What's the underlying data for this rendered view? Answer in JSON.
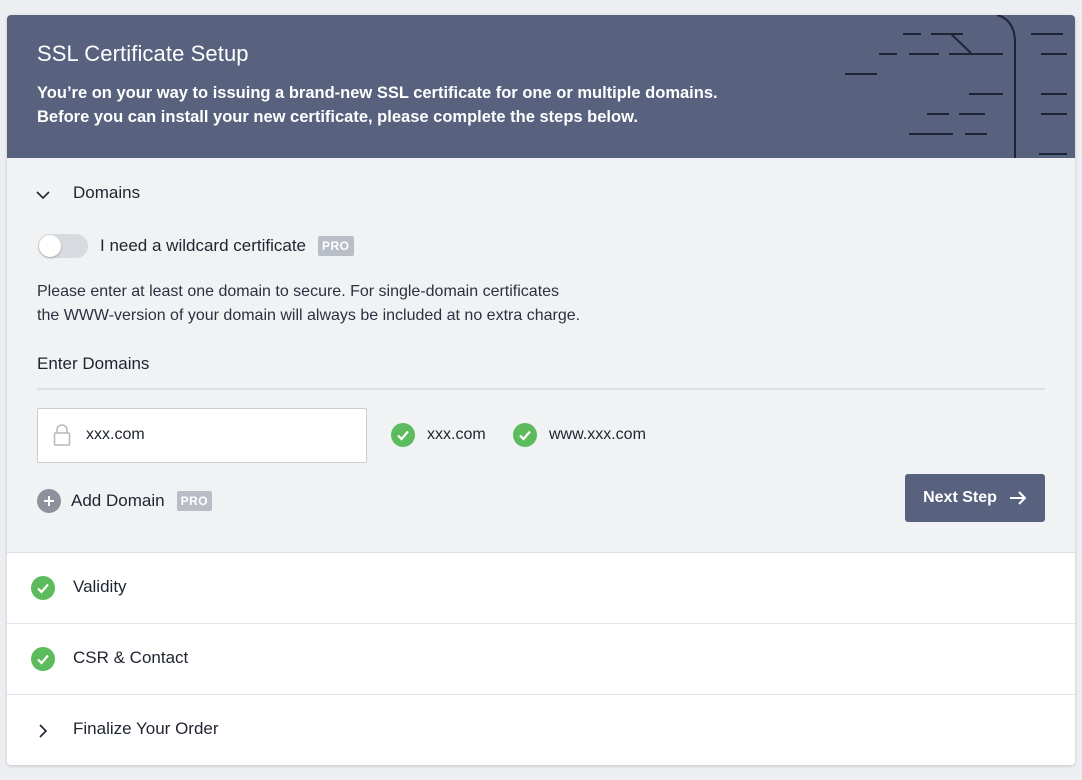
{
  "header": {
    "title": "SSL Certificate Setup",
    "description_line1": "You’re on your way to issuing a brand-new SSL certificate for one or multiple domains.",
    "description_line2": "Before you can install your new certificate, please complete the steps below."
  },
  "domains_section": {
    "title": "Domains",
    "wildcard_label": "I need a wildcard certificate",
    "wildcard_enabled": false,
    "pro_badge": "PRO",
    "info_line1": "Please enter at least one domain to secure. For single-domain certificates",
    "info_line2": "the WWW-version of your domain will always be included at no extra charge.",
    "enter_label": "Enter Domains",
    "input_value": "xxx.com",
    "validated_domains": [
      "xxx.com",
      "www.xxx.com"
    ],
    "add_domain_label": "Add Domain",
    "add_domain_badge": "PRO",
    "next_button": "Next Step"
  },
  "steps": [
    {
      "label": "Validity",
      "status": "complete"
    },
    {
      "label": "CSR & Contact",
      "status": "complete"
    },
    {
      "label": "Finalize Your Order",
      "status": "collapsed"
    }
  ],
  "colors": {
    "header_bg": "#58627f",
    "panel_bg": "#f1f2f4",
    "success": "#5cbb5c",
    "badge_bg": "#b9bdc5",
    "button_bg": "#58627f"
  },
  "icons": {
    "collapse": "chevron-down-icon",
    "expand": "chevron-right-icon",
    "done": "check-circle-icon",
    "lock": "lock-icon",
    "add": "plus-circle-icon",
    "next": "arrow-right-icon"
  }
}
